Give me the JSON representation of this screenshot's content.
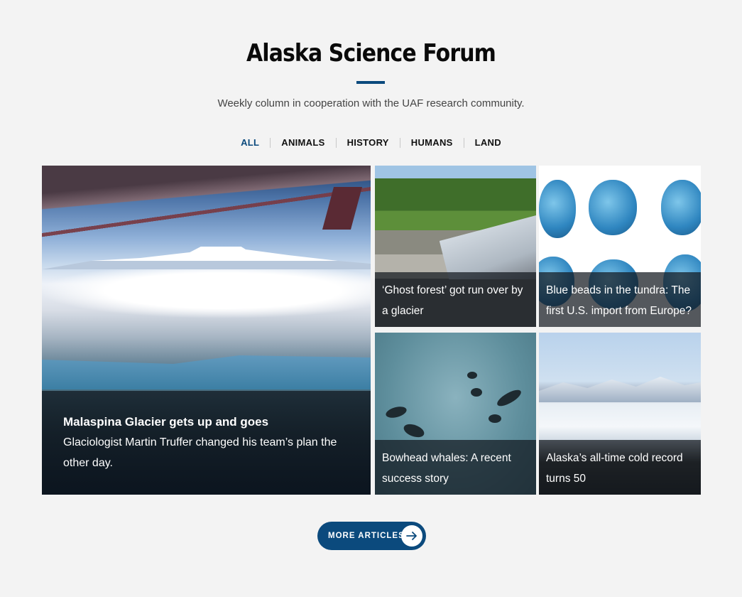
{
  "page": {
    "title": "Alaska Science Forum",
    "subtitle": "Weekly column in cooperation with the UAF research community."
  },
  "filters": [
    {
      "label": "ALL",
      "active": true
    },
    {
      "label": "ANIMALS",
      "active": false
    },
    {
      "label": "HISTORY",
      "active": false
    },
    {
      "label": "HUMANS",
      "active": false
    },
    {
      "label": "LAND",
      "active": false
    }
  ],
  "featured": {
    "title": "Malaspina Glacier gets up and goes",
    "description": "Glaciologist Martin Truffer changed his team’s plan the other day."
  },
  "articles": [
    {
      "title": "‘Ghost forest’ got run over by a glacier"
    },
    {
      "title": "Blue beads in the tundra: The first U.S. import from Europe?"
    },
    {
      "title": "Bowhead whales: A recent success story"
    },
    {
      "title": "Alaska’s all-time cold record turns 50"
    }
  ],
  "more_button": {
    "label": "MORE ARTICLES",
    "icon": "arrow-right-icon"
  },
  "colors": {
    "accent": "#0b4a7d",
    "background": "#f3f3f3"
  }
}
